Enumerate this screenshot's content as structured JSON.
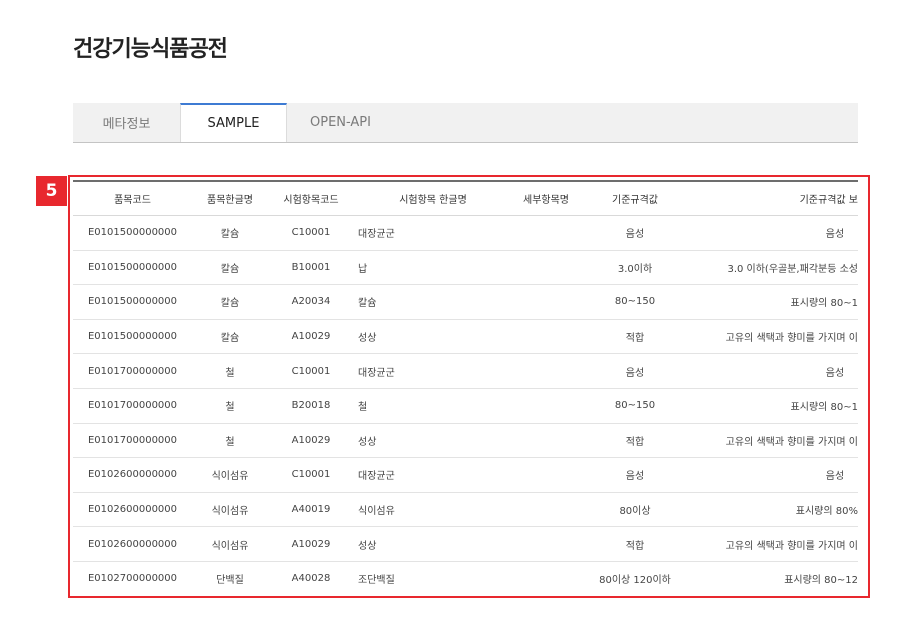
{
  "page": {
    "title": "건강기능식품공전"
  },
  "tabs": [
    {
      "label": "메타정보",
      "active": false
    },
    {
      "label": "SAMPLE",
      "active": true
    },
    {
      "label": "OPEN-API",
      "active": false
    }
  ],
  "annotation": {
    "badge": "5"
  },
  "table": {
    "columns": [
      "품목코드",
      "품목한글명",
      "시험항목코드",
      "시험항목 한글명",
      "세부항목명",
      "기준규격값",
      "기준규격값 보"
    ],
    "rows": [
      [
        "E0101500000000",
        "칼슘",
        "C10001",
        "대장균군",
        "",
        "음성",
        "음성"
      ],
      [
        "E0101500000000",
        "칼슘",
        "B10001",
        "납",
        "",
        "3.0이하",
        "3.0 이하(우골분,패각분등 소성"
      ],
      [
        "E0101500000000",
        "칼슘",
        "A20034",
        "칼슘",
        "",
        "80~150",
        "표시량의 80~1"
      ],
      [
        "E0101500000000",
        "칼슘",
        "A10029",
        "성상",
        "",
        "적합",
        "고유의 색택과 향미를 가지며 이"
      ],
      [
        "E0101700000000",
        "철",
        "C10001",
        "대장균군",
        "",
        "음성",
        "음성"
      ],
      [
        "E0101700000000",
        "철",
        "B20018",
        "철",
        "",
        "80~150",
        "표시량의 80~1"
      ],
      [
        "E0101700000000",
        "철",
        "A10029",
        "성상",
        "",
        "적합",
        "고유의 색택과 향미를 가지며 이"
      ],
      [
        "E0102600000000",
        "식이섬유",
        "C10001",
        "대장균군",
        "",
        "음성",
        "음성"
      ],
      [
        "E0102600000000",
        "식이섬유",
        "A40019",
        "식이섬유",
        "",
        "80이상",
        "표시량의 80%"
      ],
      [
        "E0102600000000",
        "식이섬유",
        "A10029",
        "성상",
        "",
        "적합",
        "고유의 색택과 향미를 가지며 이"
      ],
      [
        "E0102700000000",
        "단백질",
        "A40028",
        "조단백질",
        "",
        "80이상 120이하",
        "표시량의 80~12"
      ]
    ]
  },
  "colors": {
    "accent": "#3e7bd3",
    "annotation": "#e8282e"
  }
}
